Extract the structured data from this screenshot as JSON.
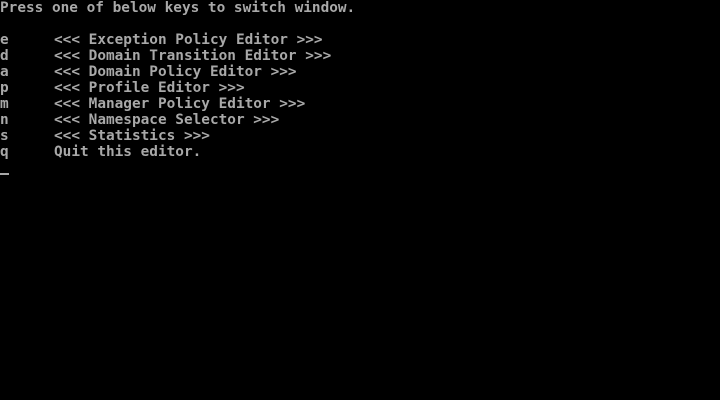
{
  "terminal": {
    "prompt": "Press one of below keys to switch window.",
    "menu": [
      {
        "key": "e",
        "label": "<<< Exception Policy Editor >>>"
      },
      {
        "key": "d",
        "label": "<<< Domain Transition Editor >>>"
      },
      {
        "key": "a",
        "label": "<<< Domain Policy Editor >>>"
      },
      {
        "key": "p",
        "label": "<<< Profile Editor >>>"
      },
      {
        "key": "m",
        "label": "<<< Manager Policy Editor >>>"
      },
      {
        "key": "n",
        "label": "<<< Namespace Selector >>>"
      },
      {
        "key": "s",
        "label": "<<< Statistics >>>"
      },
      {
        "key": "q",
        "label": "Quit this editor."
      }
    ]
  },
  "colors": {
    "background": "#000000",
    "text": "#a8a8a8"
  }
}
